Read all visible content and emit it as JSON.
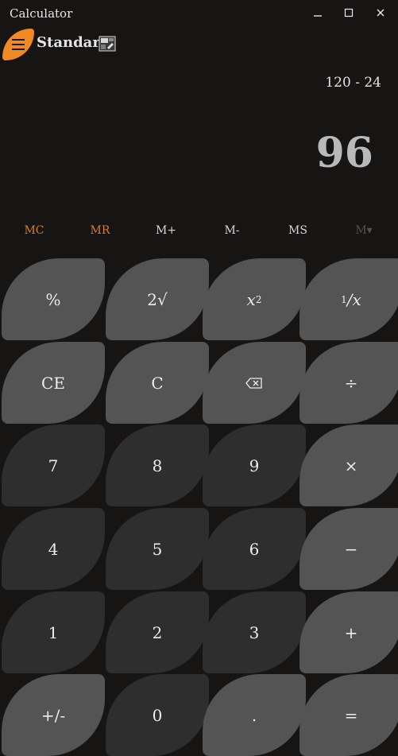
{
  "window": {
    "title": "Calculator",
    "minimize_label": "Minimize",
    "maximize_label": "Maximize",
    "close_label": "Close"
  },
  "header": {
    "mode": "Standard",
    "menu_icon": "hamburger-icon",
    "keep_on_top_icon": "keep-on-top-icon"
  },
  "display": {
    "expression": "120 - 24",
    "result": "96"
  },
  "memory": {
    "mc": "MC",
    "mr": "MR",
    "m_plus": "M+",
    "m_minus": "M-",
    "ms": "MS",
    "m_list": "M▾"
  },
  "keys": {
    "percent": "%",
    "sqrt": "2√",
    "square": "x",
    "square_sup": "2",
    "reciprocal_num": "1",
    "reciprocal_den": "/x",
    "ce": "CE",
    "c": "C",
    "backspace_icon": "backspace-icon",
    "divide": "÷",
    "seven": "7",
    "eight": "8",
    "nine": "9",
    "multiply": "×",
    "four": "4",
    "five": "5",
    "six": "6",
    "minus": "−",
    "one": "1",
    "two": "2",
    "three": "3",
    "plus": "+",
    "negate": "+/-",
    "zero": "0",
    "decimal": ".",
    "equals": "="
  },
  "colors": {
    "background": "#171414",
    "accent": "#ef8a25",
    "memory_active": "#d57e2b",
    "key_light": "#545454",
    "key_dark": "#2e2e2e"
  }
}
